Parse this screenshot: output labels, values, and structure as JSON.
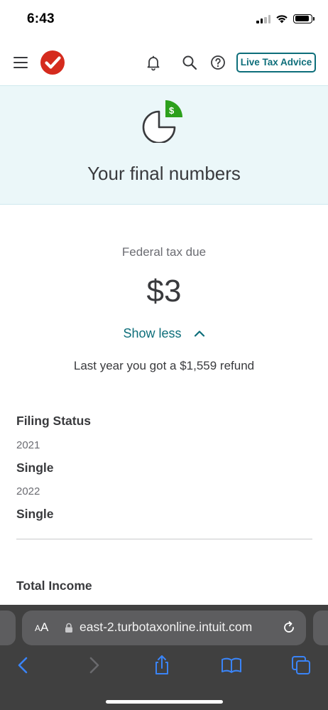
{
  "status_bar": {
    "time": "6:43"
  },
  "header": {
    "menu_icon": "hamburger-menu-icon",
    "logo": "turbotax-check-logo",
    "notification_icon": "bell-icon",
    "search_icon": "search-icon",
    "help_icon": "help-circle-icon",
    "live_advice_label": "Live Tax Advice",
    "accent_color": "#0d6e7a",
    "brand_color": "#d52b1e"
  },
  "hero": {
    "icon": "pie-chart-dollar-icon",
    "title": "Your final numbers",
    "background": "#ebf7f9"
  },
  "summary": {
    "label": "Federal tax due",
    "amount": "$3",
    "toggle_label": "Show less",
    "last_year_text": "Last year you got a $1,559 refund"
  },
  "filing_status": {
    "title": "Filing Status",
    "years": [
      {
        "year": "2021",
        "value": "Single"
      },
      {
        "year": "2022",
        "value": "Single"
      }
    ]
  },
  "total_income": {
    "title": "Total Income"
  },
  "browser": {
    "text_size_label": "AA",
    "url": "east-2.turbotaxonline.intuit.com",
    "toolbar_icons": [
      "back-icon",
      "forward-icon",
      "share-icon",
      "bookmarks-icon",
      "tabs-icon"
    ]
  }
}
